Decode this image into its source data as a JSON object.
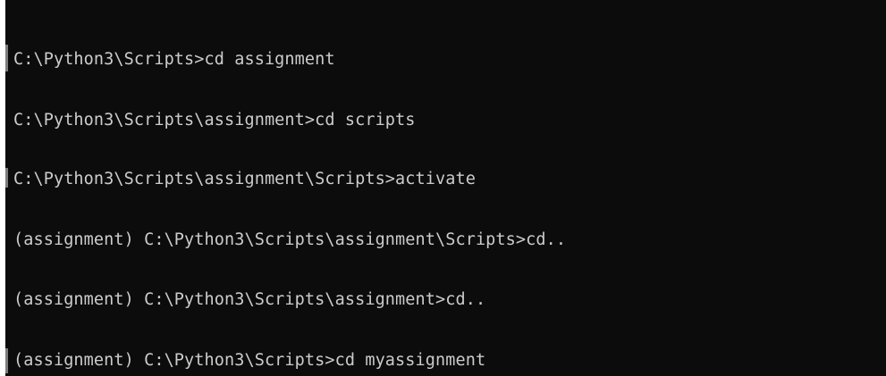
{
  "terminal": {
    "lines": [
      "C:\\Python3\\Scripts>cd assignment",
      "C:\\Python3\\Scripts\\assignment>cd scripts",
      "C:\\Python3\\Scripts\\assignment\\Scripts>activate",
      "(assignment) C:\\Python3\\Scripts\\assignment\\Scripts>cd..",
      "(assignment) C:\\Python3\\Scripts\\assignment>cd..",
      "(assignment) C:\\Python3\\Scripts>cd myassignment"
    ]
  },
  "colors": {
    "background": "#0c0c0c",
    "foreground": "#cccccc"
  }
}
